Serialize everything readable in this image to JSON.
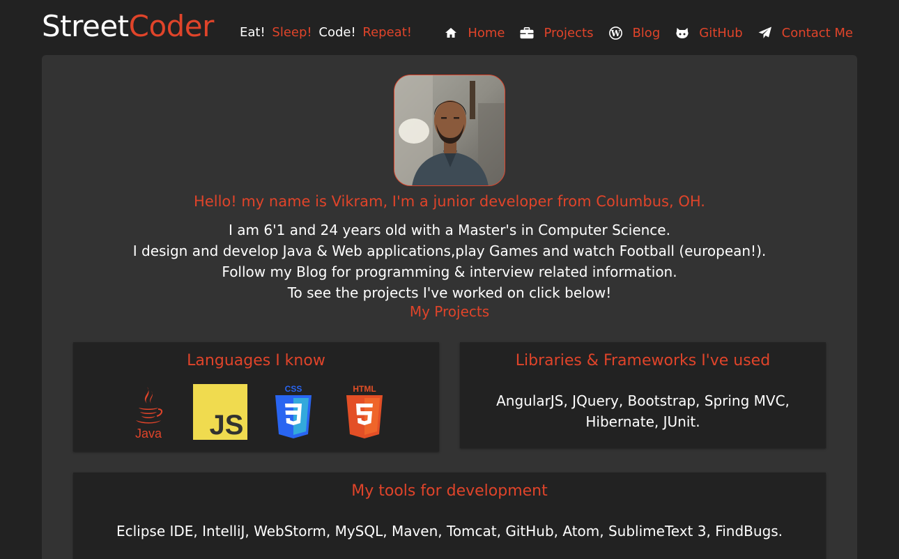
{
  "header": {
    "brand_part1": "Street",
    "brand_part2": "Coder",
    "tagline": [
      {
        "text": "Eat!",
        "color": "white"
      },
      {
        "text": "Sleep!",
        "color": "accent"
      },
      {
        "text": "Code!",
        "color": "white"
      },
      {
        "text": "Repeat!",
        "color": "accent"
      }
    ]
  },
  "nav": {
    "items": [
      {
        "label": "Home",
        "icon": "home-icon"
      },
      {
        "label": "Projects",
        "icon": "briefcase-icon"
      },
      {
        "label": "Blog",
        "icon": "wordpress-icon"
      },
      {
        "label": "GitHub",
        "icon": "github-icon"
      },
      {
        "label": "Contact Me",
        "icon": "paper-plane-icon"
      }
    ]
  },
  "intro": {
    "heading": "Hello! my name is Vikram, I'm a junior developer from Columbus, OH.",
    "lines": [
      "I am 6'1 and 24 years old with a Master's in Computer Science.",
      "I design and develop Java & Web applications,play Games and watch Football (european!).",
      "Follow my Blog for programming & interview related information.",
      "To see the projects I've worked on click below!"
    ],
    "projects_link": "My Projects"
  },
  "languages": {
    "title": "Languages I know",
    "icons": [
      {
        "name": "java-icon",
        "label": "Java"
      },
      {
        "name": "javascript-icon",
        "label": "JS"
      },
      {
        "name": "css3-icon",
        "label": "CSS"
      },
      {
        "name": "html5-icon",
        "label": "HTML"
      }
    ]
  },
  "libraries": {
    "title": "Libraries & Frameworks I've used",
    "line1": "AngularJS, JQuery, Bootstrap, Spring MVC,",
    "line2": "Hibernate, JUnit."
  },
  "tools": {
    "title": "My tools for development",
    "text": "Eclipse IDE, IntelliJ, WebStorm, MySQL, Maven, Tomcat, GitHub, Atom, SublimeText 3, FindBugs."
  },
  "colors": {
    "background": "#222222",
    "card": "#333333",
    "accent": "#e0442a",
    "text": "#ffffff"
  }
}
